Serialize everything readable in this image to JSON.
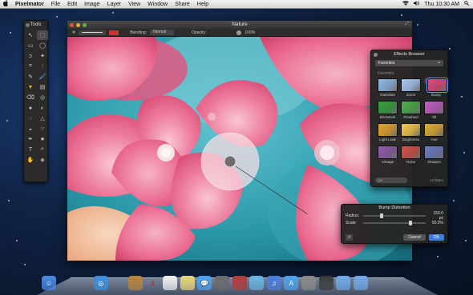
{
  "menubar": {
    "apple": "",
    "app_name": "Pixelmator",
    "menus": [
      "File",
      "Edit",
      "Image",
      "Layer",
      "View",
      "Window",
      "Share",
      "Help"
    ],
    "clock": "Thu 10:30 AM",
    "icons": [
      "wifi-icon",
      "volume-icon",
      "spotlight-icon"
    ]
  },
  "tools": {
    "title": "Tools",
    "items": [
      "move-tool",
      "selection-tool",
      "rect-select",
      "ellipse-select",
      "lasso",
      "magic-wand",
      "crop",
      "eyedropper",
      "pencil",
      "brush",
      "paint-bucket",
      "gradient",
      "eraser",
      "clone-stamp",
      "dodge",
      "burn",
      "blur",
      "sharpen",
      "sponge",
      "smudge",
      "pen",
      "shape",
      "text",
      "zoom",
      "hand",
      "color-picker"
    ]
  },
  "window": {
    "title": "Nature",
    "options": {
      "blending_label": "Blending:",
      "blending_value": "Normal",
      "opacity_label": "Opacity:",
      "opacity_value": "100%"
    }
  },
  "effects": {
    "title": "Effects Browser",
    "category": "Favorites",
    "section": "Favorites",
    "items": [
      {
        "label": "Gaussian",
        "color": "#8fb9e3"
      },
      {
        "label": "Zoom",
        "color": "#a7c9f0"
      },
      {
        "label": "Bump",
        "color": "#d94b7a"
      },
      {
        "label": "Brickwork",
        "color": "#3aa040"
      },
      {
        "label": "Pinwheel",
        "color": "#4fae50"
      },
      {
        "label": "Tilt",
        "color": "#c061c4"
      },
      {
        "label": "Light Leak",
        "color": "#e0a530"
      },
      {
        "label": "Brightness",
        "color": "#f2c94c"
      },
      {
        "label": "Hue",
        "color": "#e0ac3a"
      },
      {
        "label": "Vintage",
        "color": "#8d5fa8"
      },
      {
        "label": "Noise",
        "color": "#d1534c"
      },
      {
        "label": "Sharpen",
        "color": "#6f7fc0"
      }
    ],
    "search_placeholder": "Q▾",
    "count": "12 filters"
  },
  "bump": {
    "title": "Bump Distortion",
    "radius_label": "Radius:",
    "radius_value": "150.0 px",
    "radius_fraction": 0.3,
    "scale_label": "Scale:",
    "scale_value": "50.0%",
    "scale_fraction": 0.75,
    "cancel": "Cancel",
    "ok": "OK"
  },
  "dock": {
    "apps": [
      {
        "name": "finder",
        "color": "#4d8de8"
      },
      {
        "name": "launchpad",
        "color": "#777"
      },
      {
        "name": "mission-control",
        "color": "#444"
      },
      {
        "name": "safari",
        "color": "#3a8fe0"
      },
      {
        "name": "mail",
        "color": "#9ab"
      },
      {
        "name": "contacts",
        "color": "#b8843a"
      },
      {
        "name": "calendar",
        "color": "#eee"
      },
      {
        "name": "reminders",
        "color": "#f0f0f0"
      },
      {
        "name": "notes",
        "color": "#e8d67a"
      },
      {
        "name": "messages",
        "color": "#4aa3f0"
      },
      {
        "name": "facetime",
        "color": "#6a6a6a"
      },
      {
        "name": "photo-booth",
        "color": "#b23b3b"
      },
      {
        "name": "iphoto",
        "color": "#6ab4e0"
      },
      {
        "name": "itunes",
        "color": "#4a7ee0"
      },
      {
        "name": "app-store",
        "color": "#4aa3f0"
      },
      {
        "name": "system-preferences",
        "color": "#8a8a8a"
      },
      {
        "name": "pixelmator",
        "color": "#3a3a3a"
      },
      {
        "name": "applications-folder",
        "color": "#6fa8e6"
      },
      {
        "name": "downloads",
        "color": "#6fa8e6"
      },
      {
        "name": "trash",
        "color": "#ccc"
      }
    ],
    "calendar_day": "3"
  }
}
